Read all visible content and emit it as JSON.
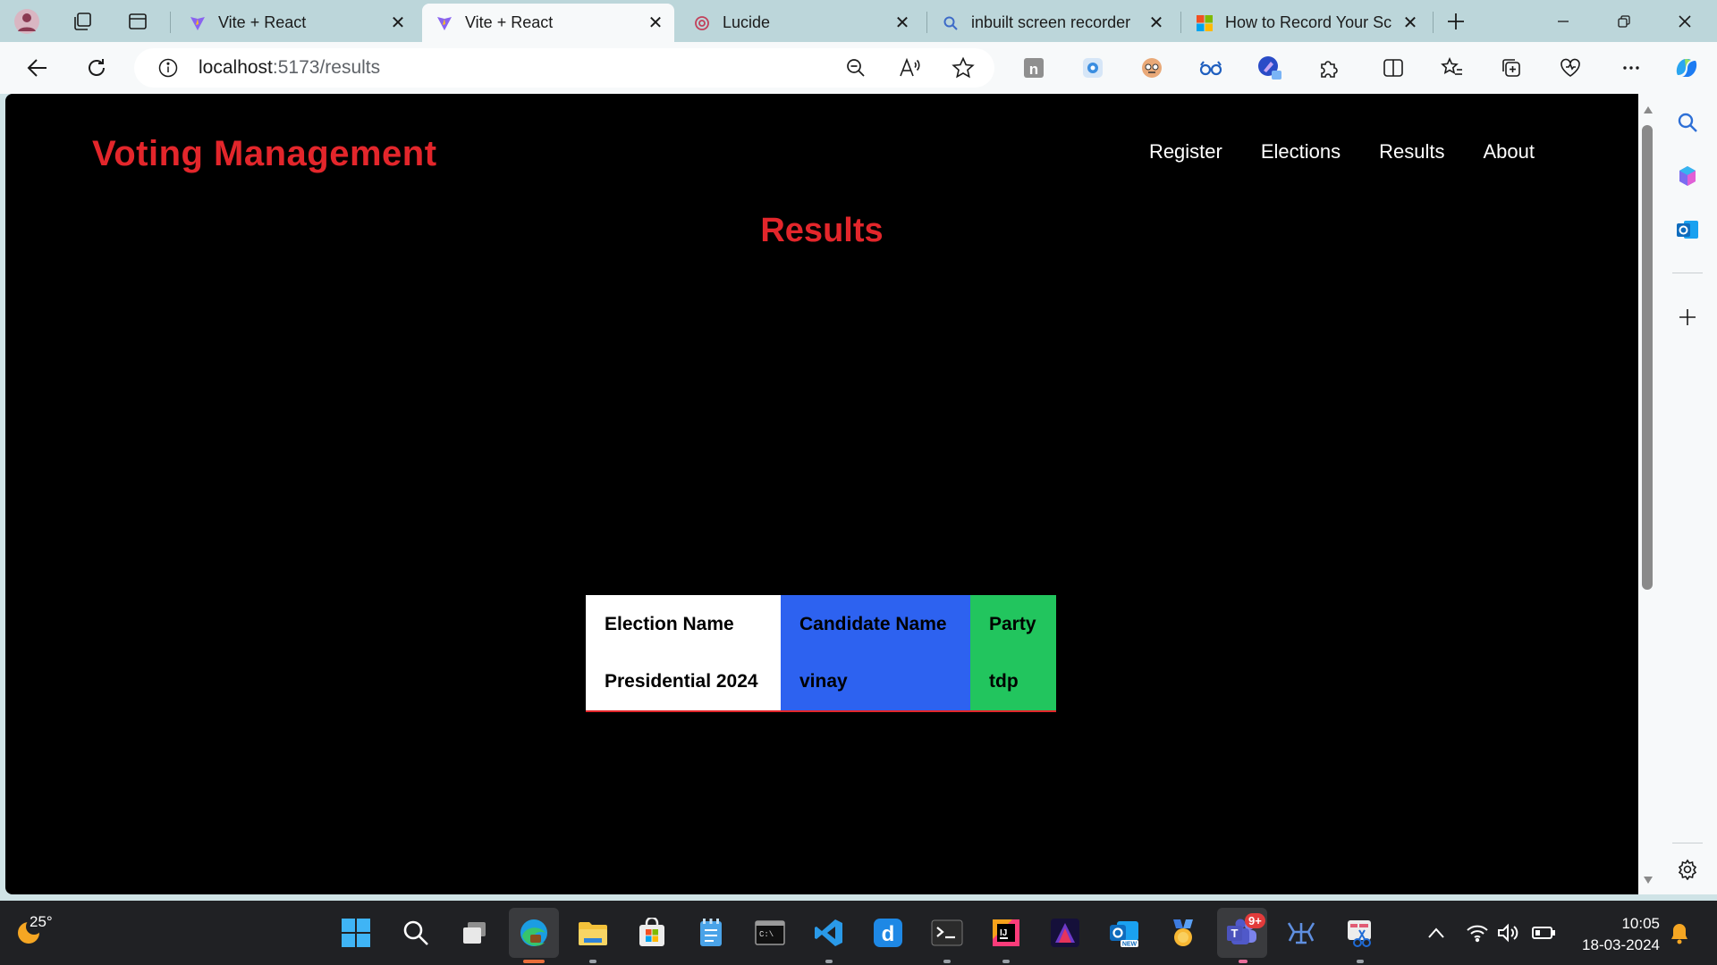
{
  "browser": {
    "tabs": [
      {
        "title": "Vite + React",
        "active": false
      },
      {
        "title": "Vite + React",
        "active": true
      },
      {
        "title": "Lucide",
        "active": false
      },
      {
        "title": "inbuilt screen recorder",
        "active": false
      },
      {
        "title": "How to Record Your Sc",
        "active": false
      }
    ],
    "url_host": "localhost",
    "url_path": ":5173/results"
  },
  "app": {
    "brand": "Voting Management",
    "nav": [
      "Register",
      "Elections",
      "Results",
      "About"
    ],
    "heading": "Results",
    "table": {
      "headers": [
        "Election Name",
        "Candidate Name",
        "Party"
      ],
      "rows": [
        [
          "Presidential 2024",
          "vinay",
          "tdp"
        ]
      ]
    },
    "colors": {
      "brand": "#e3262b",
      "col_election": "#ffffff",
      "col_candidate": "#2d62f0",
      "col_party": "#22c55e"
    }
  },
  "taskbar": {
    "weather_temp": "25°",
    "time": "10:05",
    "date": "18-03-2024",
    "teams_badge": "9+"
  }
}
